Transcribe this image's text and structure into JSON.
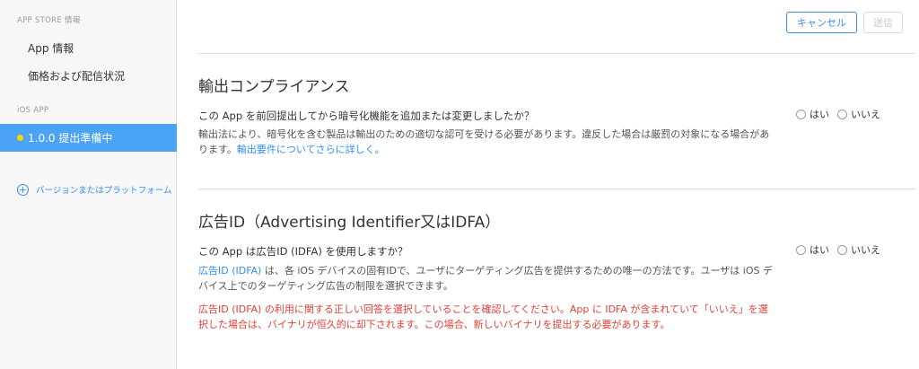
{
  "sidebar": {
    "section_app_store": "APP STORE 情報",
    "item_app_info": "App 情報",
    "item_pricing": "価格および配信状況",
    "section_ios_app": "iOS APP",
    "active_version": "1.0.0 提出準備中",
    "add_version": "バージョンまたはプラットフォーム"
  },
  "toolbar": {
    "cancel_label": "キャンセル",
    "submit_label": "送信"
  },
  "export_compliance": {
    "title": "輸出コンプライアンス",
    "question": "この App を前回提出してから暗号化機能を追加または変更しましたか？",
    "description": "輸出法により、暗号化を含む製品は輸出のための適切な認可を受ける必要があります。違反した場合は厳罰の対象になる場合があります。",
    "link": "輸出要件についてさらに詳しく。",
    "yes_label": "はい",
    "no_label": "いいえ"
  },
  "idfa": {
    "title": "広告ID（Advertising Identifier又はIDFA）",
    "question": "この App は広告ID (IDFA) を使用しますか？",
    "link": "広告ID (IDFA)",
    "description": " は、各 iOS デバイスの固有IDで、ユーザにターゲティング広告を提供するための唯一の方法です。ユーザは iOS デバイス上でのターゲティング広告の制限を選択できます。",
    "warning": "広告ID (IDFA) の利用に関する正しい回答を選択していることを確認してください。App に IDFA が含まれていて「いいえ」を選択した場合は、バイナリが恒久的に却下されます。この場合、新しいバイナリを提出する必要があります。",
    "yes_label": "はい",
    "no_label": "いいえ"
  }
}
